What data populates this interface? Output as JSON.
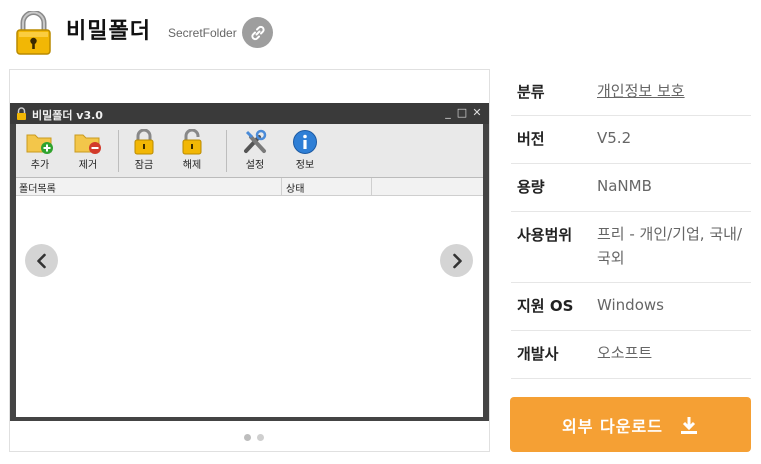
{
  "header": {
    "title": "비밀폴더",
    "subtitle": "SecretFolder",
    "app_icon": "padlock-icon",
    "link_icon": "link-icon"
  },
  "gallery": {
    "prev_icon": "chevron-left-icon",
    "next_icon": "chevron-right-icon",
    "slide_count": 2,
    "active_slide": 1
  },
  "screenshot_window": {
    "title": "비밀폴더 v3.0",
    "toolbar": [
      {
        "label": "추가",
        "icon": "folder-add-icon"
      },
      {
        "label": "제거",
        "icon": "folder-remove-icon"
      },
      {
        "label": "잠금",
        "icon": "lock-icon"
      },
      {
        "label": "해제",
        "icon": "unlock-icon"
      },
      {
        "label": "설정",
        "icon": "tools-icon"
      },
      {
        "label": "정보",
        "icon": "info-icon"
      }
    ],
    "columns": [
      "폴더목록",
      "상태"
    ]
  },
  "info": {
    "rows": [
      {
        "key": "분류",
        "value": "개인정보 보호",
        "link": true
      },
      {
        "key": "버전",
        "value": "V5.2"
      },
      {
        "key": "용량",
        "value": "NaNMB"
      },
      {
        "key": "사용범위",
        "value": "프리 - 개인/기업, 국내/국외"
      },
      {
        "key": "지원 OS",
        "value": "Windows"
      },
      {
        "key": "개발사",
        "value": "오소프트"
      }
    ]
  },
  "download": {
    "label": "외부 다운로드",
    "icon": "download-icon"
  },
  "colors": {
    "accent": "#f5a034",
    "link_button": "#9e9e9e",
    "window_frame": "#444444"
  }
}
